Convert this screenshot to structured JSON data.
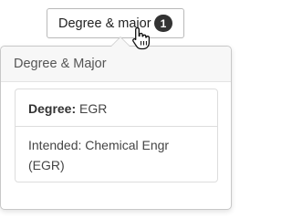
{
  "trigger": {
    "label": "Degree & major",
    "badge_count": "1"
  },
  "popover": {
    "title": "Degree & Major",
    "degree_label": "Degree:",
    "degree_value": "EGR",
    "intended_text": "Intended: Chemical Engr (EGR)"
  },
  "colors": {
    "badge_bg": "#333333",
    "header_bg": "#f7f7f7",
    "border": "#c8c8c8"
  },
  "icons": {
    "cursor": "hand-pointer-cursor-icon"
  }
}
